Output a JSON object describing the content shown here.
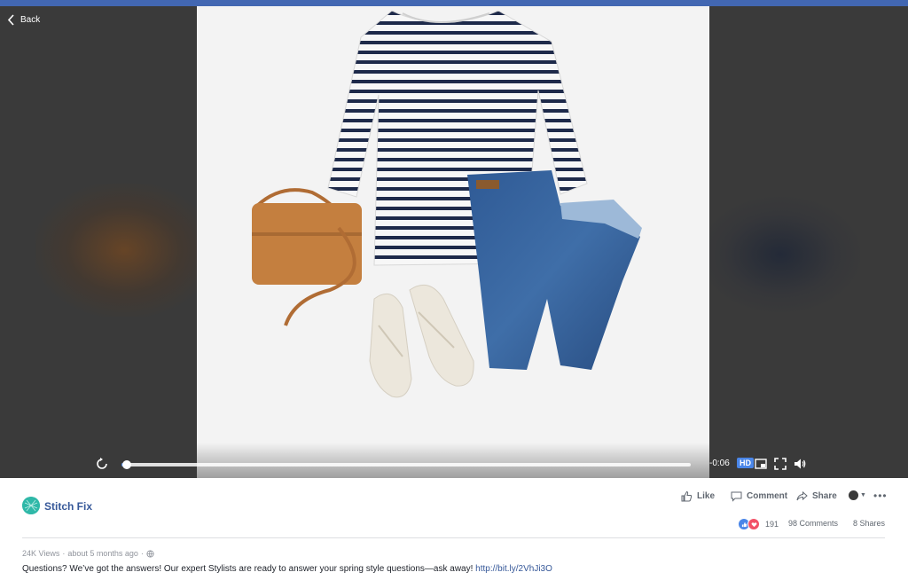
{
  "nav": {
    "back_label": "Back"
  },
  "player": {
    "time_remaining": "-0:06",
    "quality_badge": "HD",
    "progress": 0.01
  },
  "post": {
    "page_name": "Stitch Fix",
    "actions": {
      "like": "Like",
      "comment": "Comment",
      "share": "Share"
    },
    "reaction_count": "191",
    "comments": "98 Comments",
    "shares": "8 Shares",
    "views": "24K Views",
    "posted": "about 5 months ago",
    "caption_text": "Questions? We’ve got the answers! Our expert Stylists are ready to answer your spring style questions—ask away! ",
    "caption_link": "http://bit.ly/2VhJi3O"
  },
  "colors": {
    "facebook_blue": "#4267b2",
    "link_blue": "#365899",
    "progress_blue": "#4a86e8",
    "brand_teal": "#2fb8a8"
  },
  "icons": {
    "back": "chevron-left-icon",
    "replay": "replay-icon",
    "pip": "picture-in-picture-icon",
    "fullscreen": "fullscreen-icon",
    "volume": "volume-icon",
    "like": "thumbs-up-icon",
    "comment": "comment-bubble-icon",
    "share": "share-arrow-icon",
    "privacy": "globe-icon"
  }
}
